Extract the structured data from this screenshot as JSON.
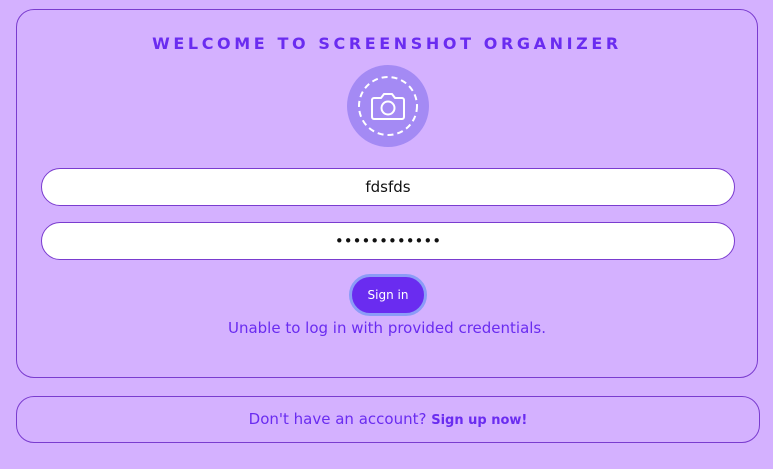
{
  "login": {
    "title": "WELCOME TO SCREENSHOT ORGANIZER",
    "logo_icon": "camera-icon",
    "username_value": "fdsfds",
    "password_value": "abcdefghijkl",
    "sign_in_label": "Sign in",
    "error_message": "Unable to log in with provided credentials."
  },
  "signup": {
    "prompt": "Don't have an account?",
    "link_label": "Sign up now!"
  },
  "colors": {
    "background": "#d4b1ff",
    "accent": "#6a2cf0",
    "logo_circle": "#a48af4"
  }
}
